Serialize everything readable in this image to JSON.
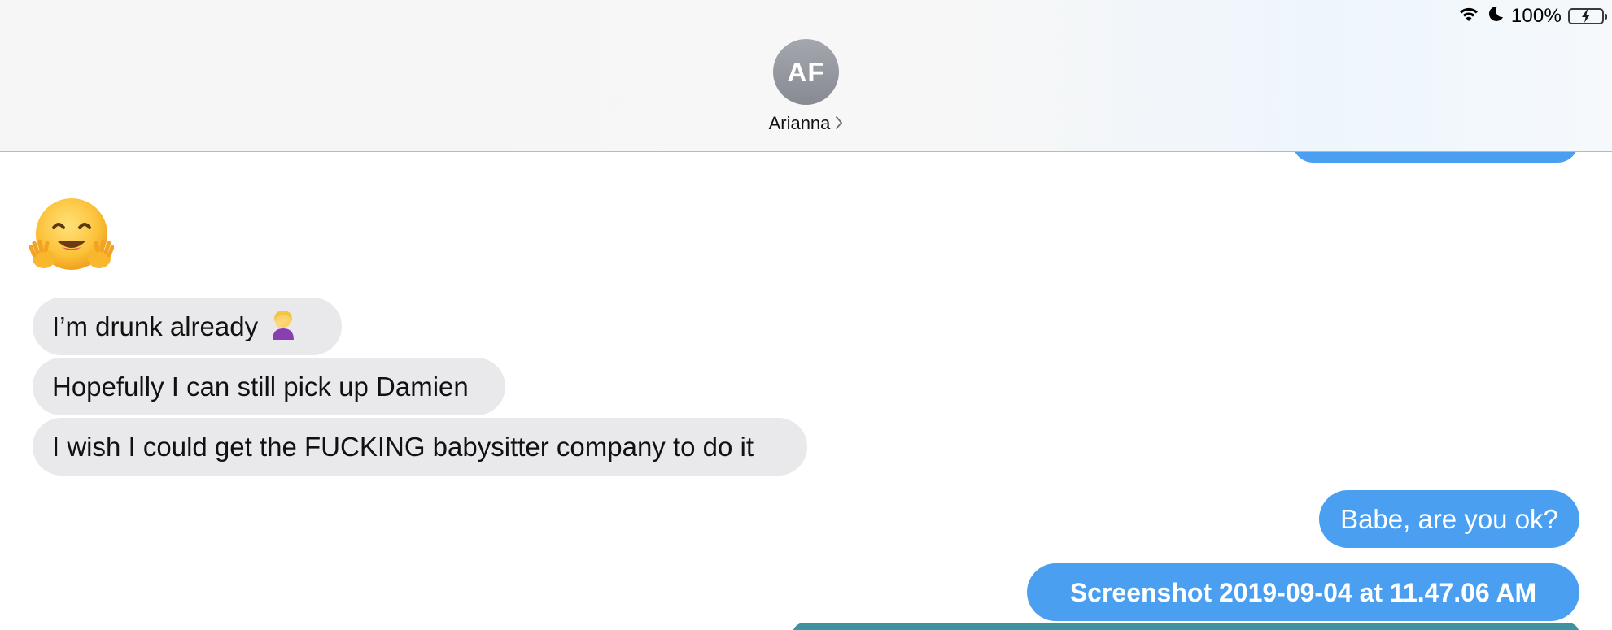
{
  "status_bar": {
    "battery_percent": "100%",
    "battery_level": 1.0,
    "icons": [
      "wifi-icon",
      "moon-icon",
      "battery-charging-icon"
    ]
  },
  "header": {
    "avatar_initials": "AF",
    "contact_name": "Arianna"
  },
  "messages": [
    {
      "type": "emoji",
      "direction": "received",
      "emoji": "hugging-face-emoji"
    },
    {
      "type": "text",
      "direction": "received",
      "text": "I’m drunk already",
      "emoji": "woman-facepalming-emoji"
    },
    {
      "type": "text",
      "direction": "received",
      "text": "Hopefully I can still pick up Damien"
    },
    {
      "type": "text",
      "direction": "received",
      "text": "I wish I could get the FUCKING babysitter company to do it"
    },
    {
      "type": "text",
      "direction": "sent",
      "text": "Babe, are you ok?"
    },
    {
      "type": "attachment",
      "direction": "sent",
      "text": "Screenshot 2019-09-04 at 11.47.06 AM"
    }
  ],
  "colors": {
    "sent_bubble": "#4b9ff0",
    "received_bubble": "#e9e9eb",
    "attachment_preview": "#3f93a0",
    "avatar": "#8e9198"
  }
}
